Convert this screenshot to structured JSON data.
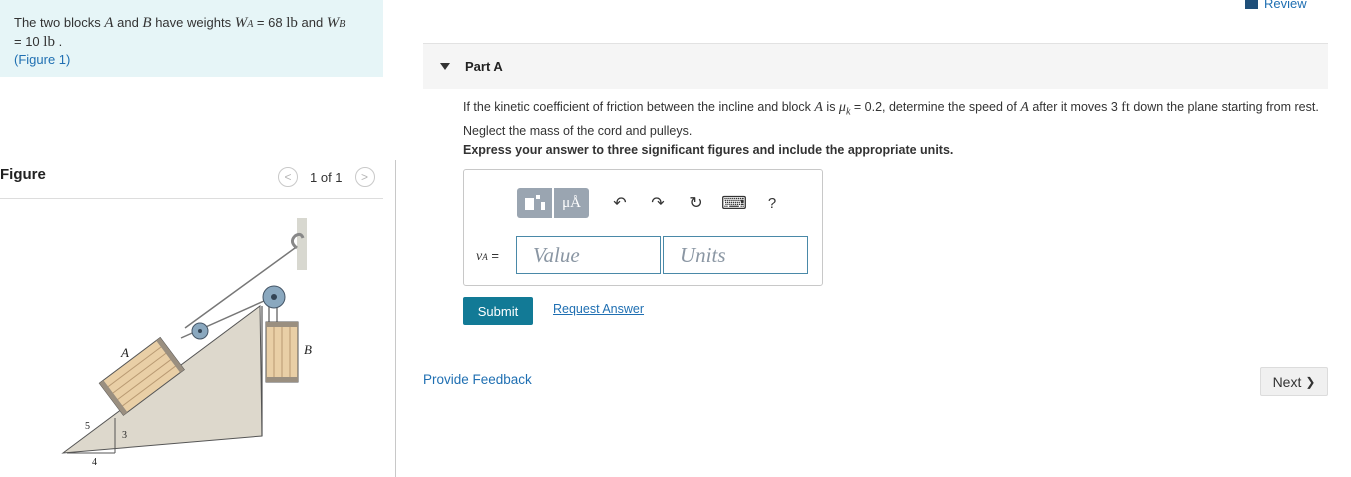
{
  "problem": {
    "intro": "The two blocks ",
    "blockA": "A",
    "and1": " and ",
    "blockB": "B",
    "have_weights": " have weights ",
    "wa_sym": "W",
    "wa_sub": "A",
    "wa_eq": " = 68 ",
    "unit_lb": "lb",
    "and2": " and ",
    "wb_sym": "W",
    "wb_sub": "B",
    "wb_eq": "= 10 ",
    "unit_lb2": "lb",
    "period": " .",
    "figure_link": "(Figure 1)"
  },
  "figure_panel": {
    "title": "Figure",
    "pager": "1 of 1",
    "prev_icon": "chevron-left-icon",
    "next_icon": "chevron-right-icon",
    "labels": {
      "a": "A",
      "b": "B",
      "slope_hyp": "5",
      "slope_rise": "3",
      "slope_run": "4"
    }
  },
  "header": {
    "review": "Review"
  },
  "part": {
    "label": "Part A",
    "question_pre": "If the kinetic coefficient of friction between the incline and block ",
    "question_blockA": "A",
    "question_is": " is ",
    "mu": "μ",
    "mu_sub": "k",
    "question_mid": " = 0.2, determine the speed of ",
    "question_blockA2": "A",
    "question_after": " after it moves 3 ",
    "question_unit": "ft",
    "question_end": " down the plane starting from rest. Neglect the mass of the cord and pulleys.",
    "instruction": "Express your answer to three significant figures and include the appropriate units."
  },
  "answer": {
    "var_sym": "v",
    "var_sub": "A",
    "equals": " =",
    "value_placeholder": "Value",
    "units_placeholder": "Units",
    "toolbar": {
      "templates_icon": "templates-icon",
      "units_btn": "μÅ",
      "undo": "↶",
      "redo": "↷",
      "reset": "↻",
      "keyboard": "⌨",
      "help": "?"
    }
  },
  "actions": {
    "submit": "Submit",
    "request_answer": "Request Answer",
    "feedback": "Provide Feedback",
    "next": "Next",
    "next_chevron": "❯"
  },
  "colors": {
    "accent": "#127a96",
    "link": "#1f6fb2",
    "problem_bg": "#e6f5f7"
  }
}
